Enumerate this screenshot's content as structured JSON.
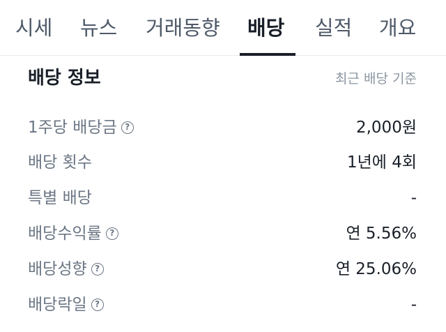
{
  "tabs": [
    {
      "label": "시세"
    },
    {
      "label": "뉴스"
    },
    {
      "label": "거래동향"
    },
    {
      "label": "배당"
    },
    {
      "label": "실적"
    },
    {
      "label": "개요"
    }
  ],
  "active_tab": "배당",
  "section": {
    "title": "배당 정보",
    "basis": "최근 배당 기준"
  },
  "rows": [
    {
      "label": "1주당 배당금",
      "value": "2,000원",
      "help_icon": "question-circle-icon"
    },
    {
      "label": "배당 횟수",
      "value": "1년에 4회"
    },
    {
      "label": "특별 배당",
      "value": "-"
    },
    {
      "label": "배당수익률",
      "value": "연 5.56%",
      "help_icon": "question-circle-icon"
    },
    {
      "label": "배당성향",
      "value": "연 25.06%",
      "help_icon": "question-circle-icon"
    },
    {
      "label": "배당락일",
      "value": "-",
      "help_icon": "question-circle-icon"
    }
  ],
  "help_glyph": "?",
  "colors": {
    "primary_text": "#191f28",
    "secondary_text": "#6b7684",
    "muted_text": "#8b95a1",
    "divider": "#e9ebee"
  }
}
